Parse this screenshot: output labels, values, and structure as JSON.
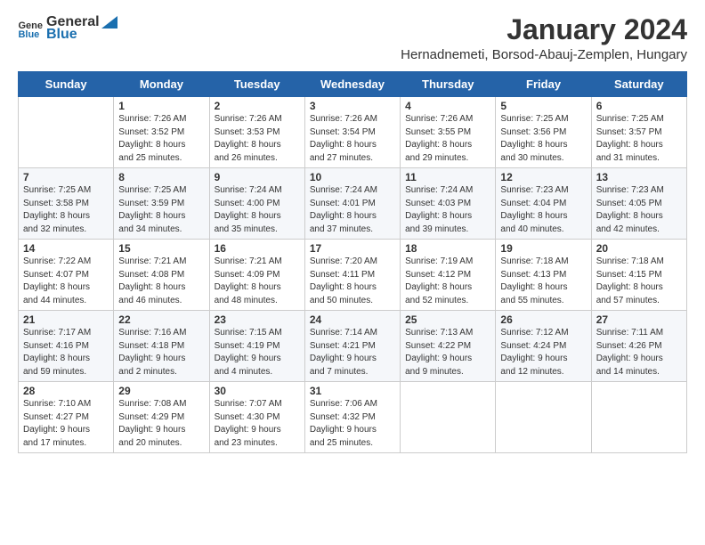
{
  "header": {
    "logo_general": "General",
    "logo_blue": "Blue",
    "title": "January 2024",
    "subtitle": "Hernadnemeti, Borsod-Abauj-Zemplen, Hungary"
  },
  "columns": [
    "Sunday",
    "Monday",
    "Tuesday",
    "Wednesday",
    "Thursday",
    "Friday",
    "Saturday"
  ],
  "weeks": [
    [
      {
        "day": "",
        "info": ""
      },
      {
        "day": "1",
        "info": "Sunrise: 7:26 AM\nSunset: 3:52 PM\nDaylight: 8 hours\nand 25 minutes."
      },
      {
        "day": "2",
        "info": "Sunrise: 7:26 AM\nSunset: 3:53 PM\nDaylight: 8 hours\nand 26 minutes."
      },
      {
        "day": "3",
        "info": "Sunrise: 7:26 AM\nSunset: 3:54 PM\nDaylight: 8 hours\nand 27 minutes."
      },
      {
        "day": "4",
        "info": "Sunrise: 7:26 AM\nSunset: 3:55 PM\nDaylight: 8 hours\nand 29 minutes."
      },
      {
        "day": "5",
        "info": "Sunrise: 7:25 AM\nSunset: 3:56 PM\nDaylight: 8 hours\nand 30 minutes."
      },
      {
        "day": "6",
        "info": "Sunrise: 7:25 AM\nSunset: 3:57 PM\nDaylight: 8 hours\nand 31 minutes."
      }
    ],
    [
      {
        "day": "7",
        "info": "Sunrise: 7:25 AM\nSunset: 3:58 PM\nDaylight: 8 hours\nand 32 minutes."
      },
      {
        "day": "8",
        "info": "Sunrise: 7:25 AM\nSunset: 3:59 PM\nDaylight: 8 hours\nand 34 minutes."
      },
      {
        "day": "9",
        "info": "Sunrise: 7:24 AM\nSunset: 4:00 PM\nDaylight: 8 hours\nand 35 minutes."
      },
      {
        "day": "10",
        "info": "Sunrise: 7:24 AM\nSunset: 4:01 PM\nDaylight: 8 hours\nand 37 minutes."
      },
      {
        "day": "11",
        "info": "Sunrise: 7:24 AM\nSunset: 4:03 PM\nDaylight: 8 hours\nand 39 minutes."
      },
      {
        "day": "12",
        "info": "Sunrise: 7:23 AM\nSunset: 4:04 PM\nDaylight: 8 hours\nand 40 minutes."
      },
      {
        "day": "13",
        "info": "Sunrise: 7:23 AM\nSunset: 4:05 PM\nDaylight: 8 hours\nand 42 minutes."
      }
    ],
    [
      {
        "day": "14",
        "info": "Sunrise: 7:22 AM\nSunset: 4:07 PM\nDaylight: 8 hours\nand 44 minutes."
      },
      {
        "day": "15",
        "info": "Sunrise: 7:21 AM\nSunset: 4:08 PM\nDaylight: 8 hours\nand 46 minutes."
      },
      {
        "day": "16",
        "info": "Sunrise: 7:21 AM\nSunset: 4:09 PM\nDaylight: 8 hours\nand 48 minutes."
      },
      {
        "day": "17",
        "info": "Sunrise: 7:20 AM\nSunset: 4:11 PM\nDaylight: 8 hours\nand 50 minutes."
      },
      {
        "day": "18",
        "info": "Sunrise: 7:19 AM\nSunset: 4:12 PM\nDaylight: 8 hours\nand 52 minutes."
      },
      {
        "day": "19",
        "info": "Sunrise: 7:18 AM\nSunset: 4:13 PM\nDaylight: 8 hours\nand 55 minutes."
      },
      {
        "day": "20",
        "info": "Sunrise: 7:18 AM\nSunset: 4:15 PM\nDaylight: 8 hours\nand 57 minutes."
      }
    ],
    [
      {
        "day": "21",
        "info": "Sunrise: 7:17 AM\nSunset: 4:16 PM\nDaylight: 8 hours\nand 59 minutes."
      },
      {
        "day": "22",
        "info": "Sunrise: 7:16 AM\nSunset: 4:18 PM\nDaylight: 9 hours\nand 2 minutes."
      },
      {
        "day": "23",
        "info": "Sunrise: 7:15 AM\nSunset: 4:19 PM\nDaylight: 9 hours\nand 4 minutes."
      },
      {
        "day": "24",
        "info": "Sunrise: 7:14 AM\nSunset: 4:21 PM\nDaylight: 9 hours\nand 7 minutes."
      },
      {
        "day": "25",
        "info": "Sunrise: 7:13 AM\nSunset: 4:22 PM\nDaylight: 9 hours\nand 9 minutes."
      },
      {
        "day": "26",
        "info": "Sunrise: 7:12 AM\nSunset: 4:24 PM\nDaylight: 9 hours\nand 12 minutes."
      },
      {
        "day": "27",
        "info": "Sunrise: 7:11 AM\nSunset: 4:26 PM\nDaylight: 9 hours\nand 14 minutes."
      }
    ],
    [
      {
        "day": "28",
        "info": "Sunrise: 7:10 AM\nSunset: 4:27 PM\nDaylight: 9 hours\nand 17 minutes."
      },
      {
        "day": "29",
        "info": "Sunrise: 7:08 AM\nSunset: 4:29 PM\nDaylight: 9 hours\nand 20 minutes."
      },
      {
        "day": "30",
        "info": "Sunrise: 7:07 AM\nSunset: 4:30 PM\nDaylight: 9 hours\nand 23 minutes."
      },
      {
        "day": "31",
        "info": "Sunrise: 7:06 AM\nSunset: 4:32 PM\nDaylight: 9 hours\nand 25 minutes."
      },
      {
        "day": "",
        "info": ""
      },
      {
        "day": "",
        "info": ""
      },
      {
        "day": "",
        "info": ""
      }
    ]
  ]
}
